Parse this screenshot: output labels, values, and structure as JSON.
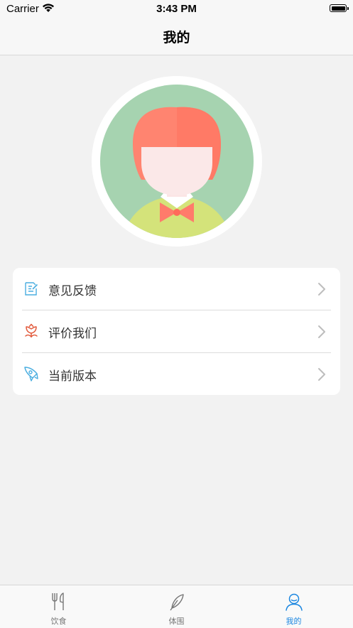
{
  "status_bar": {
    "carrier": "Carrier",
    "time": "3:43 PM"
  },
  "nav": {
    "title": "我的"
  },
  "menu": {
    "items": [
      {
        "label": "意见反馈",
        "icon": "feedback-icon"
      },
      {
        "label": "评价我们",
        "icon": "flower-icon"
      },
      {
        "label": "当前版本",
        "icon": "rocket-icon"
      }
    ]
  },
  "tabs": [
    {
      "label": "饮食",
      "icon": "fork-knife-icon",
      "active": false
    },
    {
      "label": "体围",
      "icon": "feather-icon",
      "active": false
    },
    {
      "label": "我的",
      "icon": "person-icon",
      "active": true
    }
  ],
  "colors": {
    "accent": "#1a86e0",
    "avatar_bg": "#a6d3b0",
    "hair": "#ff8470",
    "shirt": "#d4e37a"
  }
}
